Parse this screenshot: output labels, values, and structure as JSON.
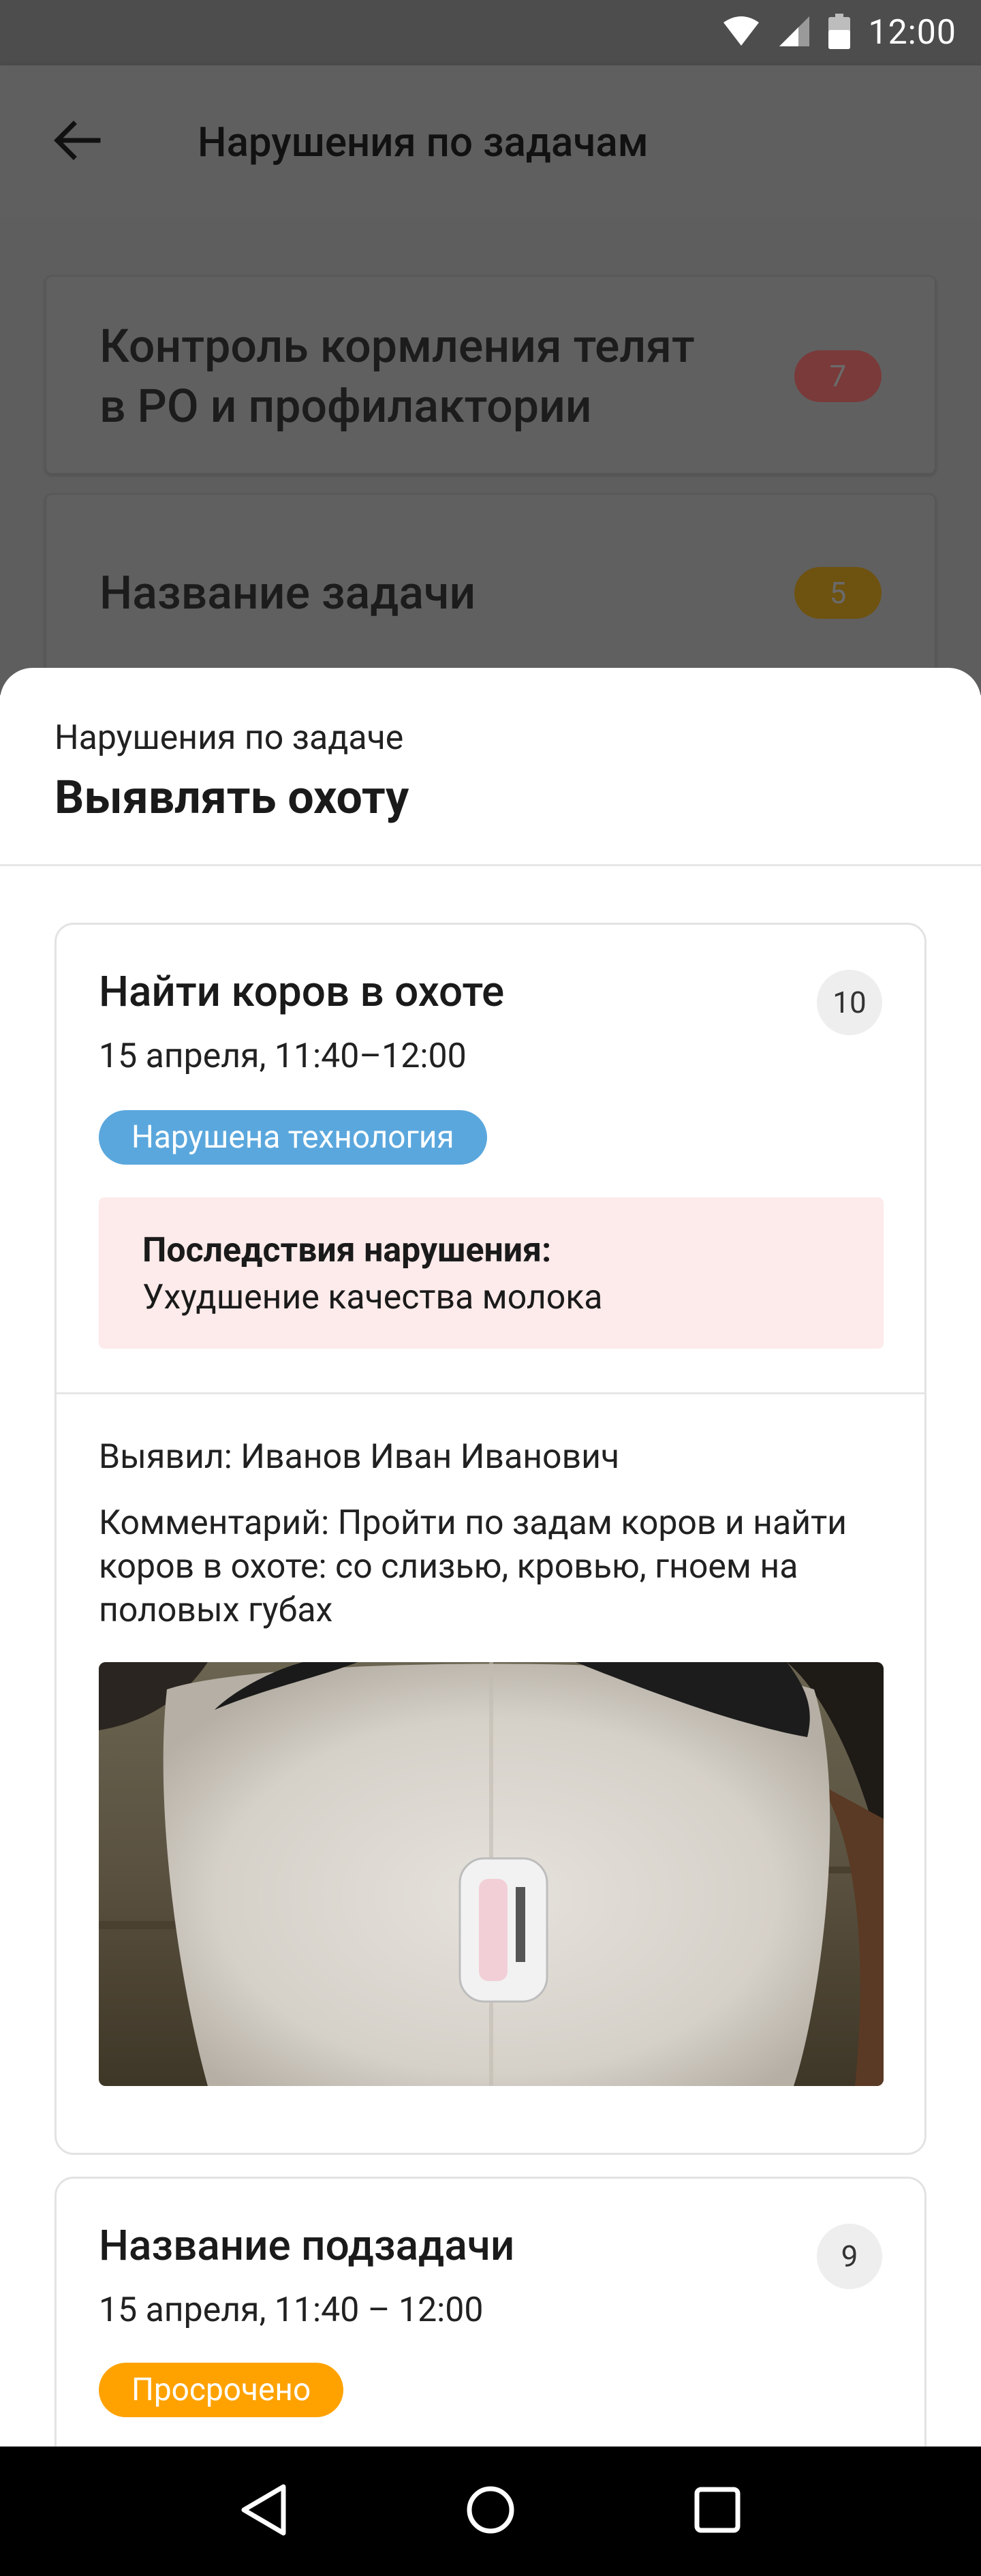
{
  "status_bar": {
    "time": "12:00",
    "icons": [
      "wifi-icon",
      "signal-icon",
      "battery-icon"
    ]
  },
  "app_bar": {
    "back_icon": "arrow-left-icon",
    "title": "Нарушения по задачам"
  },
  "background_tasks": [
    {
      "title_line1": "Контроль кормления телят",
      "title_line2": "в РО и профилактории",
      "count": "7",
      "badge_color": "#8a3a3a"
    },
    {
      "title": "Название задачи",
      "count": "5",
      "badge_color": "#7a5a10"
    }
  ],
  "sheet": {
    "subtitle": "Нарушения по задаче",
    "title": "Выявлять охоту",
    "cards": [
      {
        "title": "Найти коров в охоте",
        "count": "10",
        "time": "15 апреля, 11:40–12:00",
        "status": "Нарушена технология",
        "status_color": "#5aa7dd",
        "consequence_label": "Последствия нарушения:",
        "consequence_value": "Ухудшение качества молока",
        "detected_by": "Выявил: Иванов Иван Иванович",
        "comment": "Комментарий: Пройти по задам коров и найти коров в охоте: со слизью, кровью, гноем на половых губах",
        "photo": "cow-back-with-sensor-photo"
      },
      {
        "title": "Название подзадачи",
        "count": "9",
        "time": "15 апреля, 11:40 – 12:00",
        "status": "Просрочено",
        "status_color": "#ffa200"
      }
    ]
  },
  "nav_bar": {
    "icons": [
      "back-triangle-icon",
      "home-circle-icon",
      "recents-square-icon"
    ]
  }
}
